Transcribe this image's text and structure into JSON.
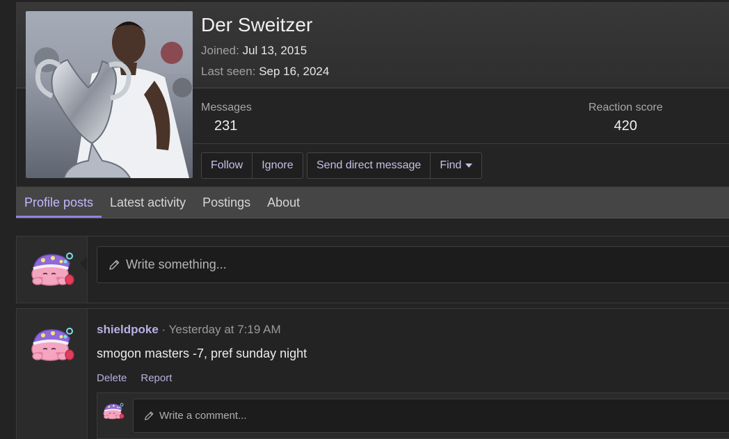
{
  "profile": {
    "name": "Der Sweitzer",
    "joined_label": "Joined:",
    "joined_value": "Jul 13, 2015",
    "last_seen_label": "Last seen:",
    "last_seen_value": "Sep 16, 2024",
    "avatar_icon": "profile-photo-trophy",
    "stats": [
      {
        "label": "Messages",
        "value": "231"
      },
      {
        "label": "Reaction score",
        "value": "420"
      }
    ],
    "buttons": {
      "follow": "Follow",
      "ignore": "Ignore",
      "send_dm": "Send direct message",
      "find": "Find"
    }
  },
  "tabs": [
    {
      "label": "Profile posts",
      "active": true
    },
    {
      "label": "Latest activity",
      "active": false
    },
    {
      "label": "Postings",
      "active": false
    },
    {
      "label": "About",
      "active": false
    }
  ],
  "compose": {
    "placeholder": "Write something...",
    "avatar_icon": "sleeping-kirby-avatar"
  },
  "post": {
    "username": "shieldpoke",
    "separator": "·",
    "timestamp": "Yesterday at 7:19 AM",
    "body": "smogon masters -7, pref sunday night",
    "actions": {
      "delete": "Delete",
      "report": "Report"
    },
    "comment_placeholder": "Write a comment...",
    "avatar_icon": "sleeping-kirby-avatar"
  },
  "colors": {
    "accent": "#c2b8ff",
    "tab_underline": "#8f84e0",
    "link": "#b8b0e0"
  }
}
